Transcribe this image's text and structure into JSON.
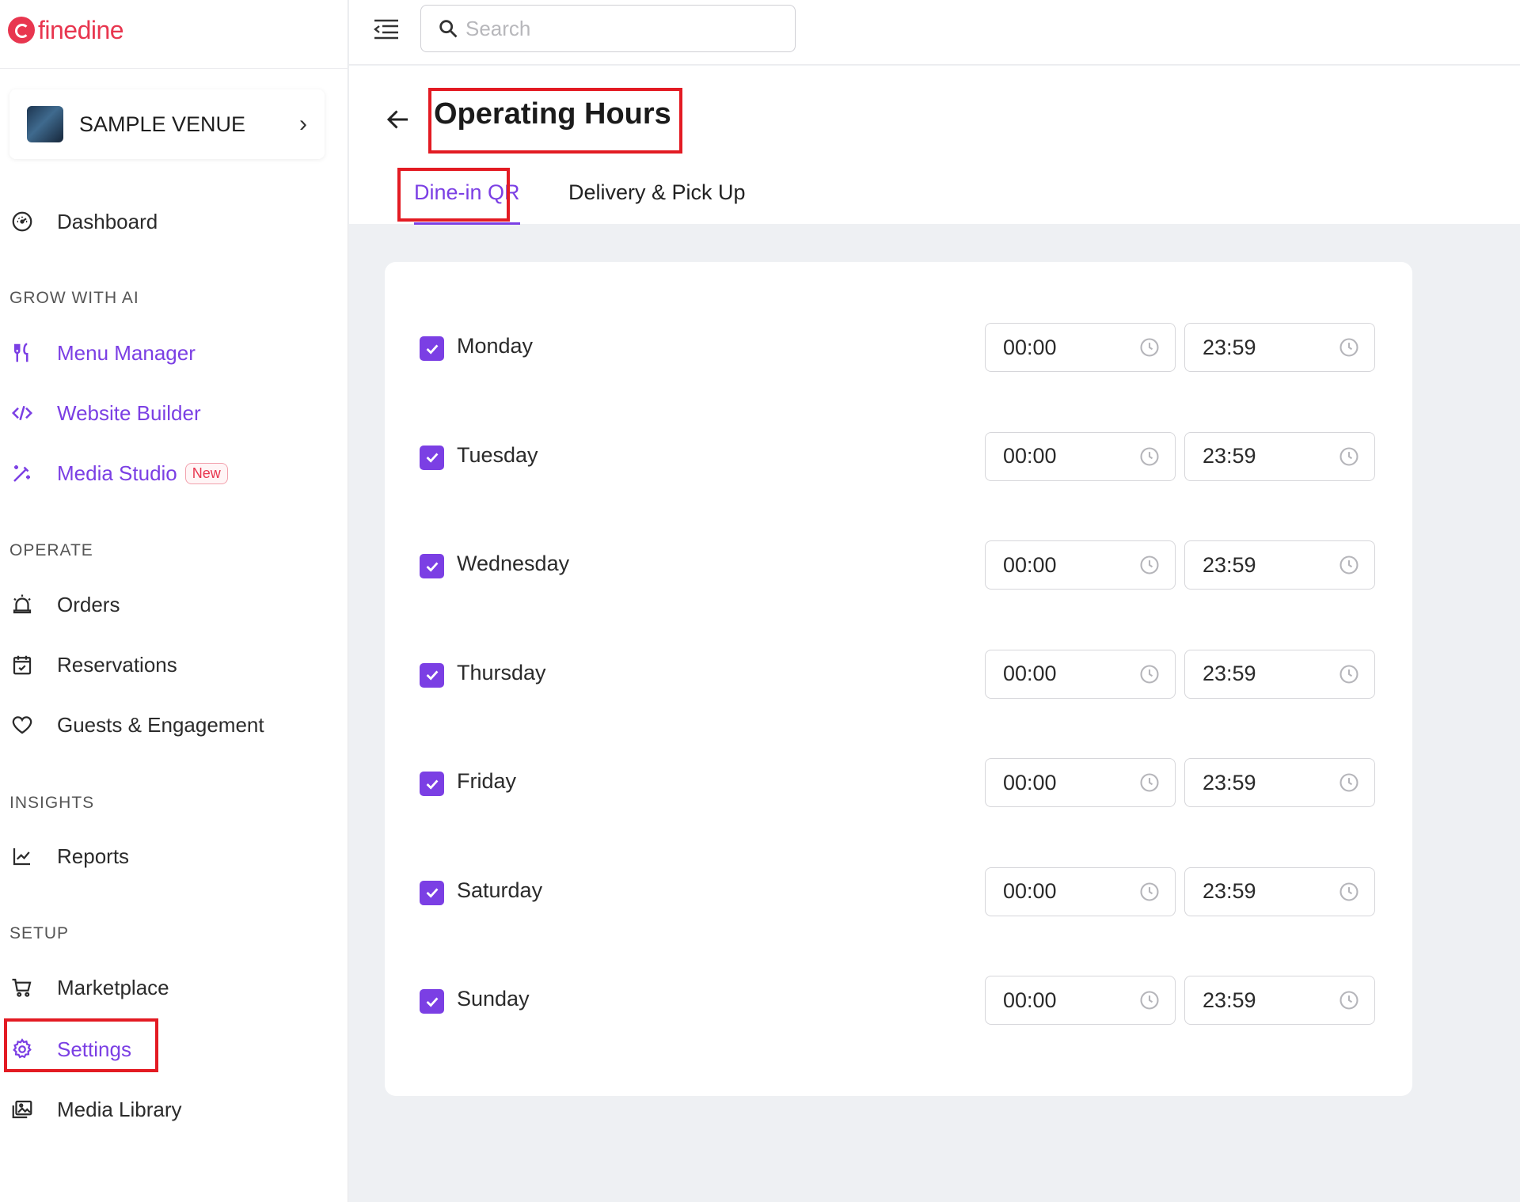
{
  "brand": {
    "name": "finedine",
    "color": "#e8364f"
  },
  "accent_color": "#7b3fe4",
  "venue": {
    "name": "SAMPLE VENUE"
  },
  "sidebar": {
    "dashboard": "Dashboard",
    "sections": {
      "grow": "GROW WITH AI",
      "operate": "OPERATE",
      "insights": "INSIGHTS",
      "setup": "SETUP"
    },
    "items": {
      "menu_manager": "Menu Manager",
      "website_builder": "Website Builder",
      "media_studio": "Media Studio",
      "media_studio_badge": "New",
      "orders": "Orders",
      "reservations": "Reservations",
      "guests": "Guests & Engagement",
      "reports": "Reports",
      "marketplace": "Marketplace",
      "settings": "Settings",
      "media_library": "Media Library"
    }
  },
  "search": {
    "placeholder": "Search"
  },
  "page": {
    "title": "Operating Hours",
    "tabs": [
      "Dine-in QR",
      "Delivery & Pick Up"
    ],
    "active_tab": "Dine-in QR"
  },
  "hours": [
    {
      "day": "Monday",
      "enabled": true,
      "open": "00:00",
      "close": "23:59"
    },
    {
      "day": "Tuesday",
      "enabled": true,
      "open": "00:00",
      "close": "23:59"
    },
    {
      "day": "Wednesday",
      "enabled": true,
      "open": "00:00",
      "close": "23:59"
    },
    {
      "day": "Thursday",
      "enabled": true,
      "open": "00:00",
      "close": "23:59"
    },
    {
      "day": "Friday",
      "enabled": true,
      "open": "00:00",
      "close": "23:59"
    },
    {
      "day": "Saturday",
      "enabled": true,
      "open": "00:00",
      "close": "23:59"
    },
    {
      "day": "Sunday",
      "enabled": true,
      "open": "00:00",
      "close": "23:59"
    }
  ]
}
